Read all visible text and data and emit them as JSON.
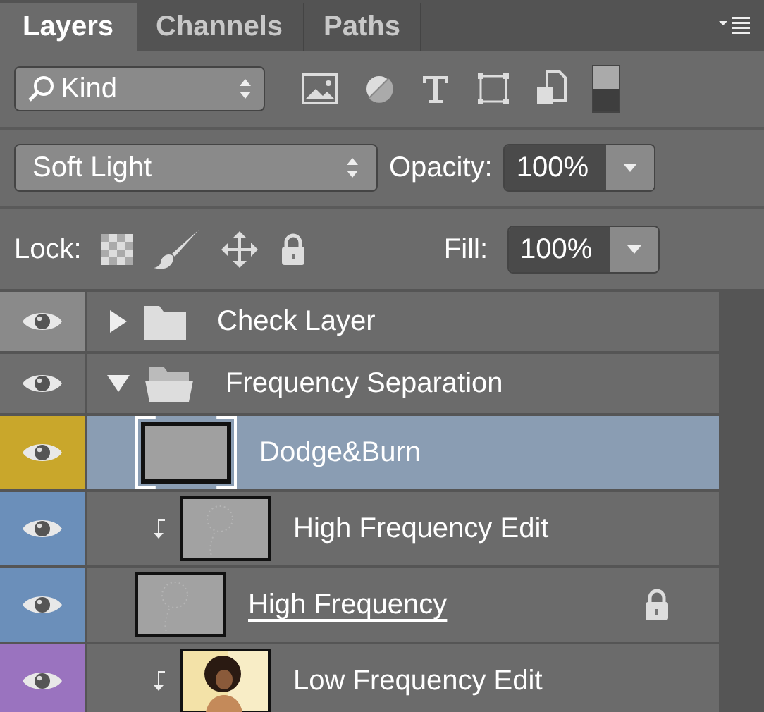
{
  "tabs": [
    {
      "label": "Layers",
      "selected": true
    },
    {
      "label": "Channels",
      "selected": false
    },
    {
      "label": "Paths",
      "selected": false
    }
  ],
  "filter": {
    "value": "Kind",
    "switch_on": true
  },
  "blend": {
    "mode": "Soft Light",
    "opacity_label": "Opacity:",
    "opacity": "100%"
  },
  "lock": {
    "label": "Lock:",
    "fill_label": "Fill:",
    "fill": "100%"
  },
  "layers": [
    {
      "kind": "group",
      "name": "Check Layer",
      "expanded": false,
      "color": "#8a8a8a",
      "selected": false
    },
    {
      "kind": "group",
      "name": "Frequency Separation",
      "expanded": true,
      "color": "#6e6e6e",
      "selected": false,
      "children": [
        {
          "kind": "fill",
          "name": "Dodge&Burn",
          "clipped": false,
          "locked": false,
          "clip_base": false,
          "color": "#c9a72b",
          "selected": true
        },
        {
          "kind": "texture",
          "name": "High Frequency Edit",
          "clipped": true,
          "locked": false,
          "clip_base": false,
          "color": "#6b8fba",
          "selected": false
        },
        {
          "kind": "texture",
          "name": "High Frequency",
          "clipped": false,
          "locked": true,
          "clip_base": true,
          "color": "#6b8fba",
          "selected": false
        },
        {
          "name": "Low Frequency Edit",
          "clipped": true,
          "locked": false,
          "clip_base": false,
          "color": "#9a73bf",
          "selected": false
        }
      ]
    }
  ]
}
